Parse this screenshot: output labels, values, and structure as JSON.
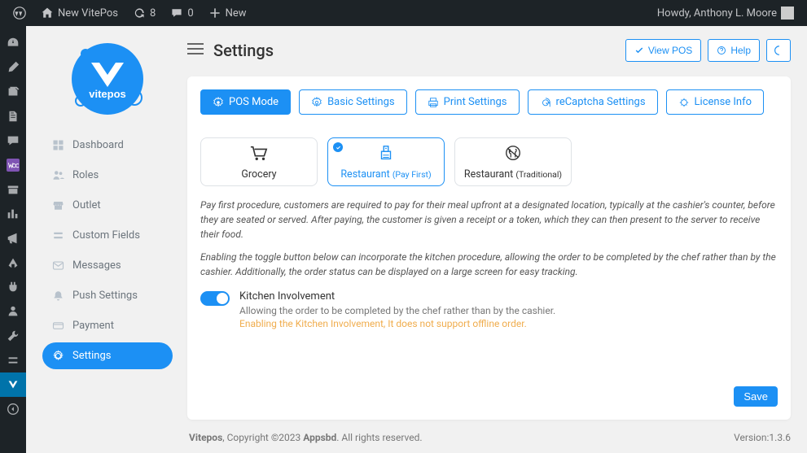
{
  "wp_toolbar": {
    "site_name": "New VitePos",
    "updates": "8",
    "comments": "0",
    "new": "New",
    "howdy": "Howdy, Anthony L. Moore"
  },
  "header": {
    "title": "Settings",
    "view_pos": "View POS",
    "help": "Help"
  },
  "nav": [
    {
      "label": "Dashboard"
    },
    {
      "label": "Roles"
    },
    {
      "label": "Outlet"
    },
    {
      "label": "Custom Fields"
    },
    {
      "label": "Messages"
    },
    {
      "label": "Push Settings"
    },
    {
      "label": "Payment"
    },
    {
      "label": "Settings"
    }
  ],
  "tabs": [
    {
      "label": "POS Mode"
    },
    {
      "label": "Basic Settings"
    },
    {
      "label": "Print Settings"
    },
    {
      "label": "reCaptcha  Settings"
    },
    {
      "label": "License Info"
    }
  ],
  "modes": {
    "grocery": "Grocery",
    "restaurant_pf": "Restaurant",
    "restaurant_pf_sub": "(Pay First)",
    "restaurant_trad": "Restaurant",
    "restaurant_trad_sub": "(Traditional)"
  },
  "desc1": "Pay first procedure, customers are required to pay for their meal upfront at a designated location, typically at the cashier's counter, before they are seated or served. After paying, the customer is given a receipt or a token, which they can then present to the server to receive their food.",
  "desc2": "Enabling the toggle button below can incorporate the kitchen procedure, allowing the order to be completed by the chef rather than by the cashier. Additionally, the order status can be displayed on a large screen for easy tracking.",
  "kitchen": {
    "title": "Kitchen Involvement",
    "desc": "Allowing the order to be completed by the chef rather than by the cashier.",
    "warn": "Enabling the Kitchen Involvement, It does not support offline order."
  },
  "save": "Save",
  "footer": {
    "copy_pre": "Vitepos",
    "copy_mid": ", Copyright ©2023 ",
    "copy_brand": "Appsbd",
    "copy_suf": ". All rights reserved.",
    "version": "Version:1.3.6"
  }
}
